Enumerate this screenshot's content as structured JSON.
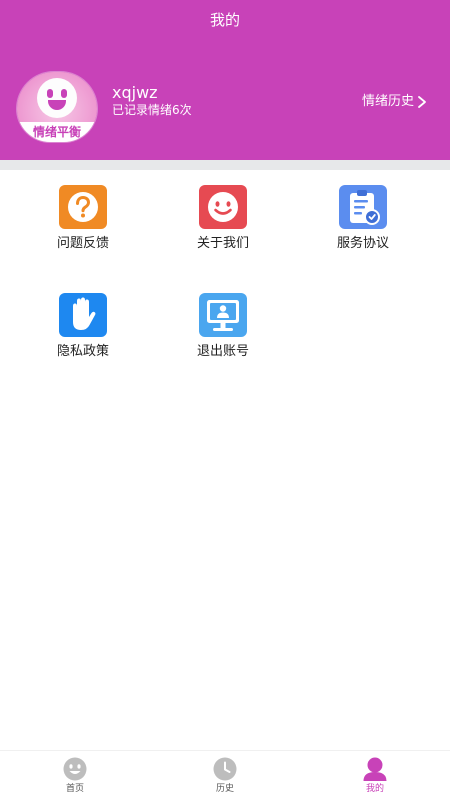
{
  "header": {
    "title": "我的"
  },
  "profile": {
    "avatar_caption": "情绪平衡",
    "username": "xqjwz",
    "record_text": "已记录情绪6次",
    "history_link": "情绪历史"
  },
  "menu": [
    {
      "label": "问题反馈",
      "icon": "question-icon",
      "color": "#f08a24"
    },
    {
      "label": "关于我们",
      "icon": "smile-icon",
      "color": "#e64a52"
    },
    {
      "label": "服务协议",
      "icon": "clipboard-icon",
      "color": "#5b8def"
    },
    {
      "label": "隐私政策",
      "icon": "hand-icon",
      "color": "#1e88f0"
    },
    {
      "label": "退出账号",
      "icon": "monitor-user-icon",
      "color": "#4aa6ef"
    }
  ],
  "tabbar": {
    "items": [
      {
        "label": "首页",
        "icon": "smiley-face-icon",
        "active": false
      },
      {
        "label": "历史",
        "icon": "clock-icon",
        "active": false
      },
      {
        "label": "我的",
        "icon": "person-icon",
        "active": true
      }
    ]
  },
  "colors": {
    "brand": "#c842b8",
    "divider": "#e7e8ea",
    "inactive_tab": "#bdbdbd"
  }
}
